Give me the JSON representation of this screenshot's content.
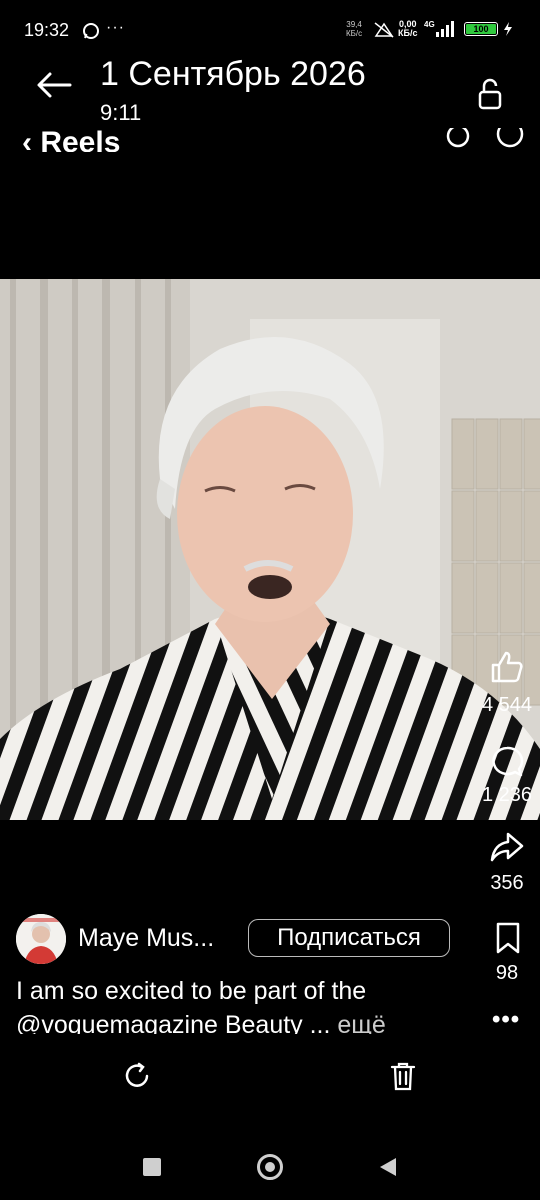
{
  "status_bar": {
    "time": "19:32",
    "more": "···",
    "speed_left_value": "39,4",
    "speed_left_unit": "КБ/с",
    "speed_right_value": "0,00",
    "speed_right_unit": "КБ/с",
    "network": "4G",
    "battery": "100"
  },
  "header": {
    "date": "1 Сентябрь 2026",
    "time": "9:11",
    "reels_title": "Reels"
  },
  "actions": {
    "likes": "4 544",
    "comments": "1 236",
    "shares": "356",
    "saves": "98",
    "more": "•••"
  },
  "post": {
    "author": "Maye Mus...",
    "follow_label": "Подписаться",
    "caption_text": "I am so excited to be part of the @voguemagazine Beauty ...",
    "caption_more": " ещё"
  },
  "colors": {
    "background": "#000000",
    "battery_fill": "#30c93e"
  }
}
